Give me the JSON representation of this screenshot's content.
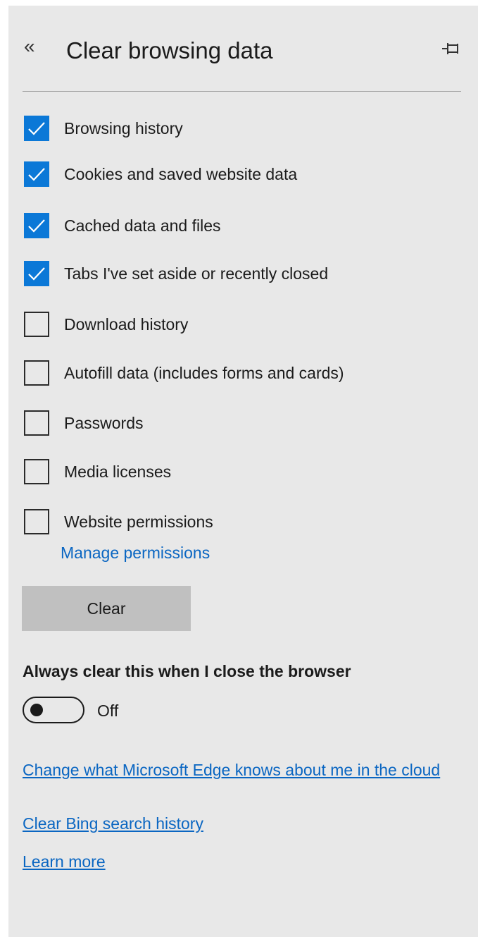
{
  "header": {
    "title": "Clear browsing data",
    "back_icon": "chevron-double-left-icon",
    "back_glyph": "«",
    "pin_icon": "pin-icon"
  },
  "checkboxes": [
    {
      "label": "Browsing history",
      "checked": true
    },
    {
      "label": "Cookies and saved website data",
      "checked": true
    },
    {
      "label": "Cached data and files",
      "checked": true
    },
    {
      "label": "Tabs I've set aside or recently closed",
      "checked": true
    },
    {
      "label": "Download history",
      "checked": false
    },
    {
      "label": "Autofill data (includes forms and cards)",
      "checked": false
    },
    {
      "label": "Passwords",
      "checked": false
    },
    {
      "label": "Media licenses",
      "checked": false
    },
    {
      "label": "Website permissions",
      "checked": false
    }
  ],
  "manage_permissions_link": "Manage permissions",
  "clear_button": "Clear",
  "always_clear": {
    "label": "Always clear this when I close the browser",
    "toggle_state": "Off"
  },
  "links": {
    "cloud": "Change what Microsoft Edge knows about me in the cloud",
    "bing": "Clear Bing search history",
    "learn_more": "Learn more"
  },
  "colors": {
    "panel_bg": "#e8e8e8",
    "accent": "#0b78d7",
    "link": "#0a66c2",
    "button_bg": "#c0c0c0"
  }
}
